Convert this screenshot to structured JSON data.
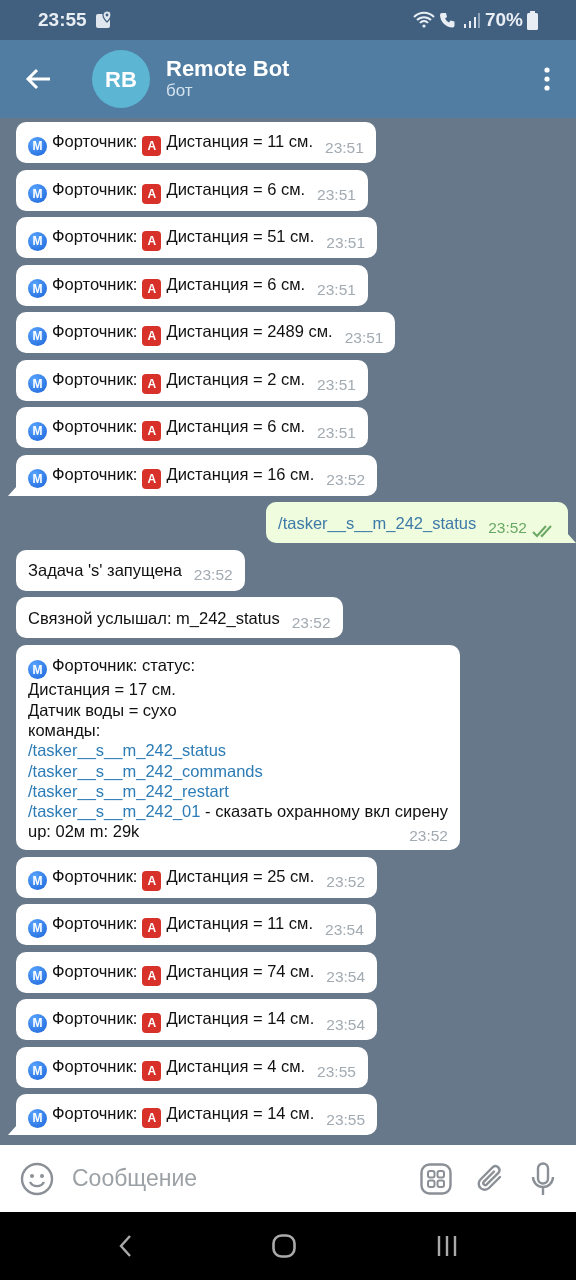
{
  "status_bar": {
    "time": "23:55",
    "battery": "70%"
  },
  "header": {
    "avatar_initials": "RB",
    "title": "Remote Bot",
    "subtitle": "бот"
  },
  "messages": [
    {
      "kind": "sensor",
      "badge": "M",
      "sender": "Форточник:",
      "alert": "A",
      "text": "Дистанция = 11 см.",
      "time": "23:51",
      "tail": false
    },
    {
      "kind": "sensor",
      "badge": "M",
      "sender": "Форточник:",
      "alert": "A",
      "text": "Дистанция = 6 см.",
      "time": "23:51",
      "tail": false
    },
    {
      "kind": "sensor",
      "badge": "M",
      "sender": "Форточник:",
      "alert": "A",
      "text": "Дистанция = 51 см.",
      "time": "23:51",
      "tail": false
    },
    {
      "kind": "sensor",
      "badge": "M",
      "sender": "Форточник:",
      "alert": "A",
      "text": "Дистанция = 6 см.",
      "time": "23:51",
      "tail": false
    },
    {
      "kind": "sensor",
      "badge": "M",
      "sender": "Форточник:",
      "alert": "A",
      "text": "Дистанция = 2489 см.",
      "time": "23:51",
      "tail": false
    },
    {
      "kind": "sensor",
      "badge": "M",
      "sender": "Форточник:",
      "alert": "A",
      "text": "Дистанция = 2 см.",
      "time": "23:51",
      "tail": false
    },
    {
      "kind": "sensor",
      "badge": "M",
      "sender": "Форточник:",
      "alert": "A",
      "text": "Дистанция = 6 см.",
      "time": "23:51",
      "tail": false
    },
    {
      "kind": "sensor",
      "badge": "M",
      "sender": "Форточник:",
      "alert": "A",
      "text": "Дистанция = 16 см.",
      "time": "23:52",
      "tail": true
    },
    {
      "kind": "command",
      "text": "/tasker__s__m_242_status",
      "time": "23:52",
      "read": true,
      "tail": true
    },
    {
      "kind": "plain",
      "text": "Задача 's' запущена",
      "time": "23:52",
      "tail": false
    },
    {
      "kind": "plain",
      "text": "Связной услышал: m_242_status",
      "time": "23:52",
      "tail": false
    },
    {
      "kind": "status",
      "badge": "M",
      "sender": "Форточник: статус:",
      "lines": [
        {
          "kind": "text",
          "text": "Дистанция = 17 см."
        },
        {
          "kind": "text",
          "text": "Датчик воды = сухо"
        },
        {
          "kind": "text",
          "text": "команды:"
        },
        {
          "kind": "link",
          "text": "/tasker__s__m_242_status"
        },
        {
          "kind": "link",
          "text": "/tasker__s__m_242_commands"
        },
        {
          "kind": "link",
          "text": "/tasker__s__m_242_restart"
        },
        {
          "kind": "link",
          "text": "/tasker__s__m_242_01",
          "note": "- сказать охранному вкл сирену"
        },
        {
          "kind": "text",
          "text": "up: 02м m: 29k"
        }
      ],
      "time": "23:52",
      "tail": false
    },
    {
      "kind": "sensor",
      "badge": "M",
      "sender": "Форточник:",
      "alert": "A",
      "text": "Дистанция = 25 см.",
      "time": "23:52",
      "tail": false
    },
    {
      "kind": "sensor",
      "badge": "M",
      "sender": "Форточник:",
      "alert": "A",
      "text": "Дистанция = 11 см.",
      "time": "23:54",
      "tail": false
    },
    {
      "kind": "sensor",
      "badge": "M",
      "sender": "Форточник:",
      "alert": "A",
      "text": "Дистанция = 74 см.",
      "time": "23:54",
      "tail": false
    },
    {
      "kind": "sensor",
      "badge": "M",
      "sender": "Форточник:",
      "alert": "A",
      "text": "Дистанция = 14 см.",
      "time": "23:54",
      "tail": false
    },
    {
      "kind": "sensor",
      "badge": "M",
      "sender": "Форточник:",
      "alert": "A",
      "text": "Дистанция = 4 см.",
      "time": "23:55",
      "tail": false
    },
    {
      "kind": "sensor",
      "badge": "M",
      "sender": "Форточник:",
      "alert": "A",
      "text": "Дистанция = 14 см.",
      "time": "23:55",
      "tail": true
    }
  ],
  "composer": {
    "placeholder": "Сообщение"
  }
}
